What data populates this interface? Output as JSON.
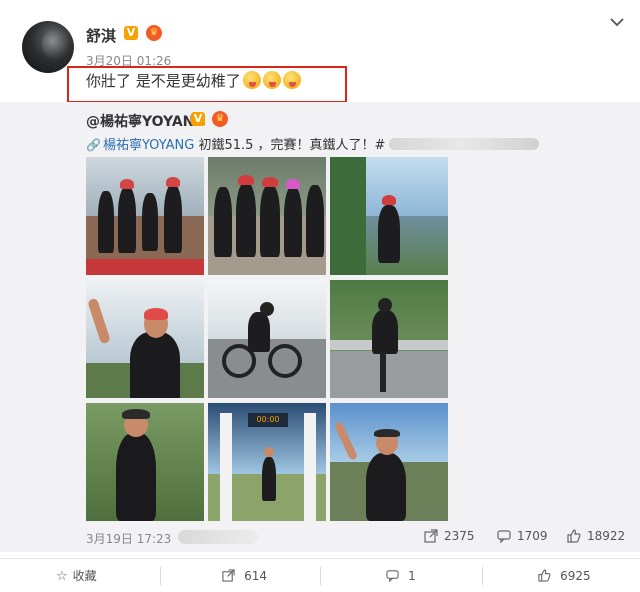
{
  "post": {
    "username": "舒淇",
    "verified_badge": "V",
    "crown_badge": "♛",
    "time": "3月20日 01:26",
    "comment": "你壯了 是不是更幼稚了",
    "menu_icon": "chevron-down-icon",
    "highlight_color": "#d9261c"
  },
  "repost": {
    "username": "@楊祐寧YOYANG",
    "verified_badge": "V",
    "crown_badge": "♛",
    "link_text": "楊祐寧YOYANG",
    "text": " 初鐵51.5 ，完賽！真鐵人了！#",
    "time": "3月19日 17:23",
    "share_count": "2375",
    "comment_count": "1709",
    "like_count": "18922",
    "photos": [
      "group-photo-1",
      "group-photo-2",
      "runner-photo",
      "wave-photo",
      "cyclist-photo-1",
      "cyclist-photo-2",
      "running-photo",
      "finish-line-photo",
      "victory-photo"
    ]
  },
  "actions": {
    "favorite_label": "收藏",
    "repost_count": "614",
    "comment_count": "1",
    "like_count": "6925"
  },
  "colors": {
    "link": "#2a6fb3",
    "badge_orange": "#f6a100",
    "panel_bg": "#f2f2f5"
  }
}
